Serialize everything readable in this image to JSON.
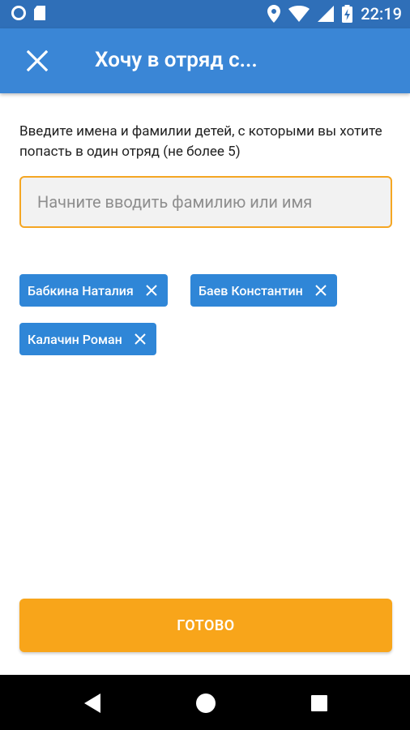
{
  "status_bar": {
    "time": "22:19",
    "icons": [
      "circle-icon",
      "sd-card-icon",
      "location-icon",
      "wifi-icon",
      "signal-icon",
      "battery-charging-icon"
    ]
  },
  "app_bar": {
    "title": "Хочу в отряд с...",
    "close_icon": "close-icon"
  },
  "instruction": "Введите имена и фамилии детей, с которыми вы хотите попасть в один отряд (не более 5)",
  "search": {
    "placeholder": "Начните вводить фамилию или имя",
    "value": ""
  },
  "chips": [
    {
      "label": "Бабкина Наталия"
    },
    {
      "label": "Баев Константин"
    },
    {
      "label": "Калачин Роман"
    }
  ],
  "done_button": {
    "label": "ГОТОВО"
  },
  "colors": {
    "app_bar": "#3a86d6",
    "status_bar": "#2f6fb8",
    "chip": "#2f86d7",
    "accent": "#f8a51a",
    "input_border": "#f5a623"
  },
  "nav_bar": {
    "icons": [
      "back-icon",
      "home-icon",
      "recents-icon"
    ]
  }
}
